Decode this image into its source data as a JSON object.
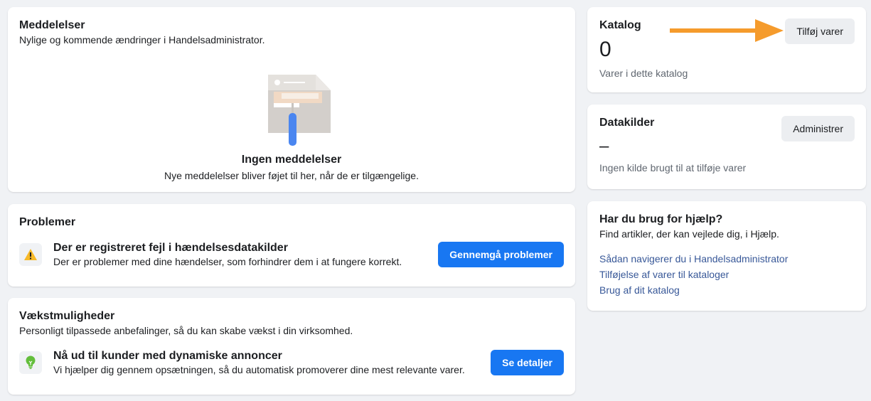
{
  "notifications": {
    "title": "Meddelelser",
    "subtitle": "Nylige og kommende ændringer i Handelsadministrator.",
    "empty_title": "Ingen meddelelser",
    "empty_subtitle": "Nye meddelelser bliver føjet til her, når de er tilgængelige."
  },
  "problems": {
    "title": "Problemer",
    "item_title": "Der er registreret fejl i hændelsesdatakilder",
    "item_subtitle": "Der er problemer med dine hændelser, som forhindrer dem i at fungere korrekt.",
    "button_label": "Gennemgå problemer",
    "icon": "warning-icon"
  },
  "growth": {
    "title": "Vækstmuligheder",
    "subtitle": "Personligt tilpassede anbefalinger, så du kan skabe vækst i din virksomhed.",
    "item_title": "Nå ud til kunder med dynamiske annoncer",
    "item_subtitle": "Vi hjælper dig gennem opsætningen, så du automatisk promoverer dine mest relevante varer.",
    "button_label": "Se detaljer",
    "icon": "lightbulb-icon"
  },
  "catalog": {
    "title": "Katalog",
    "count": "0",
    "caption": "Varer i dette katalog",
    "button_label": "Tilføj varer"
  },
  "datasources": {
    "title": "Datakilder",
    "value": "–",
    "caption": "Ingen kilde brugt til at tilføje varer",
    "button_label": "Administrer"
  },
  "help": {
    "title": "Har du brug for hjælp?",
    "subtitle": "Find artikler, der kan vejlede dig, i Hjælp.",
    "links": [
      "Sådan navigerer du i Handelsadministrator",
      "Tilføjelse af varer til kataloger",
      "Brug af dit katalog"
    ]
  },
  "colors": {
    "primary": "#1877f2",
    "link": "#385898",
    "arrow": "#f59b2c",
    "warning": "#f7b928",
    "growth": "#63be3b"
  }
}
